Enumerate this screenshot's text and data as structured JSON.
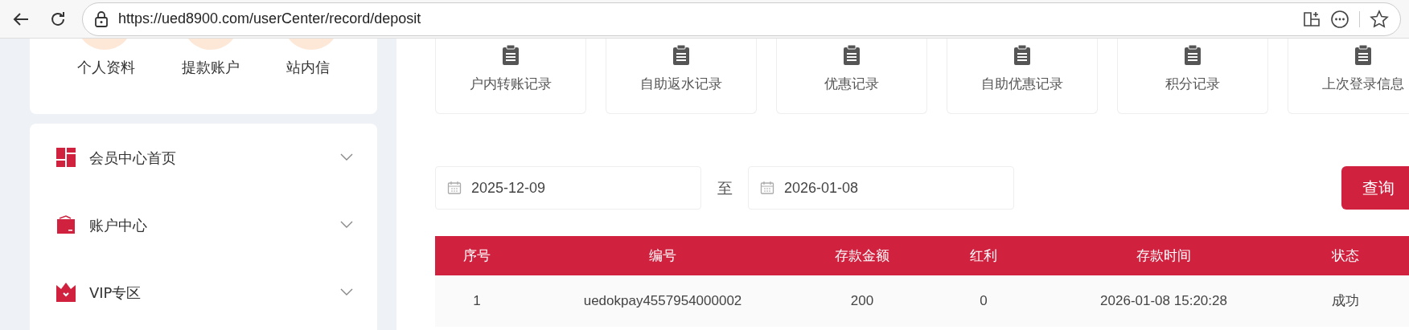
{
  "browser": {
    "url": "https://ued8900.com/userCenter/record/deposit"
  },
  "profile_links": [
    "个人资料",
    "提款账户",
    "站内信"
  ],
  "sidebar": {
    "items": [
      {
        "label": "会员中心首页",
        "expanded": false
      },
      {
        "label": "账户中心",
        "expanded": false
      },
      {
        "label": "VIP专区",
        "expanded": false
      }
    ]
  },
  "record_tabs": [
    "户内转账记录",
    "自助返水记录",
    "优惠记录",
    "自助优惠记录",
    "积分记录",
    "上次登录信息"
  ],
  "date_range": {
    "start": "2025-12-09",
    "separator": "至",
    "end": "2026-01-08"
  },
  "query_button": "查询",
  "table": {
    "columns": [
      "序号",
      "编号",
      "存款金额",
      "红利",
      "存款时间",
      "状态"
    ],
    "rows": [
      [
        "1",
        "uedokpay4557954000002",
        "200",
        "0",
        "2026-01-08 15:20:28",
        "成功"
      ]
    ]
  }
}
